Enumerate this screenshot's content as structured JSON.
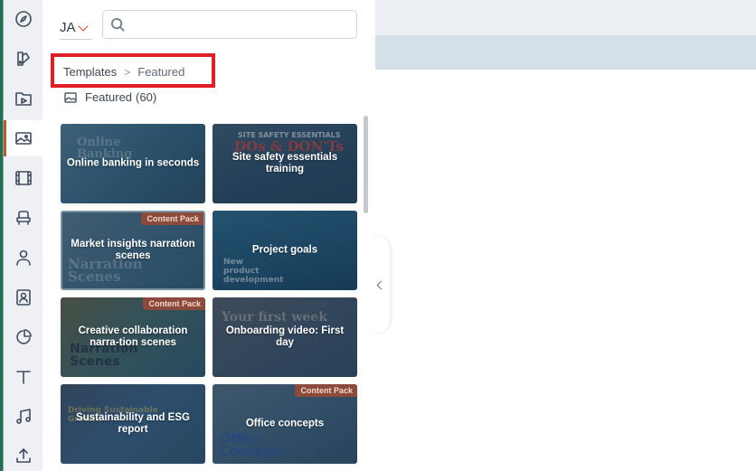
{
  "header": {
    "workspace_initials": "JA",
    "search_placeholder": ""
  },
  "breadcrumb": {
    "root": "Templates",
    "separator": ">",
    "current": "Featured"
  },
  "folder": {
    "name": "Featured",
    "count": "(60)"
  },
  "rail": {
    "icons": [
      "compass-icon",
      "brush-icon",
      "video-folder-icon",
      "image-icon",
      "film-icon",
      "chair-icon",
      "person-icon",
      "contact-icon",
      "pie-chart-icon",
      "text-icon",
      "music-icon",
      "upload-icon"
    ],
    "active_index": 3
  },
  "templates": [
    {
      "title": "Online banking in seconds",
      "badge": ""
    },
    {
      "title": "Site safety essentials training",
      "badge": ""
    },
    {
      "title": "Market insights narration scenes",
      "badge": "Content Pack"
    },
    {
      "title": "Project goals",
      "badge": ""
    },
    {
      "title": "Creative collaboration narra-tion scenes",
      "badge": "Content Pack"
    },
    {
      "title": "Onboarding video: First day",
      "badge": ""
    },
    {
      "title": "Sustainability and ESG report",
      "badge": ""
    },
    {
      "title": "Office concepts",
      "badge": "Content Pack"
    }
  ],
  "colors": {
    "accent": "#c0582b",
    "highlight_box": "#e01e26"
  }
}
